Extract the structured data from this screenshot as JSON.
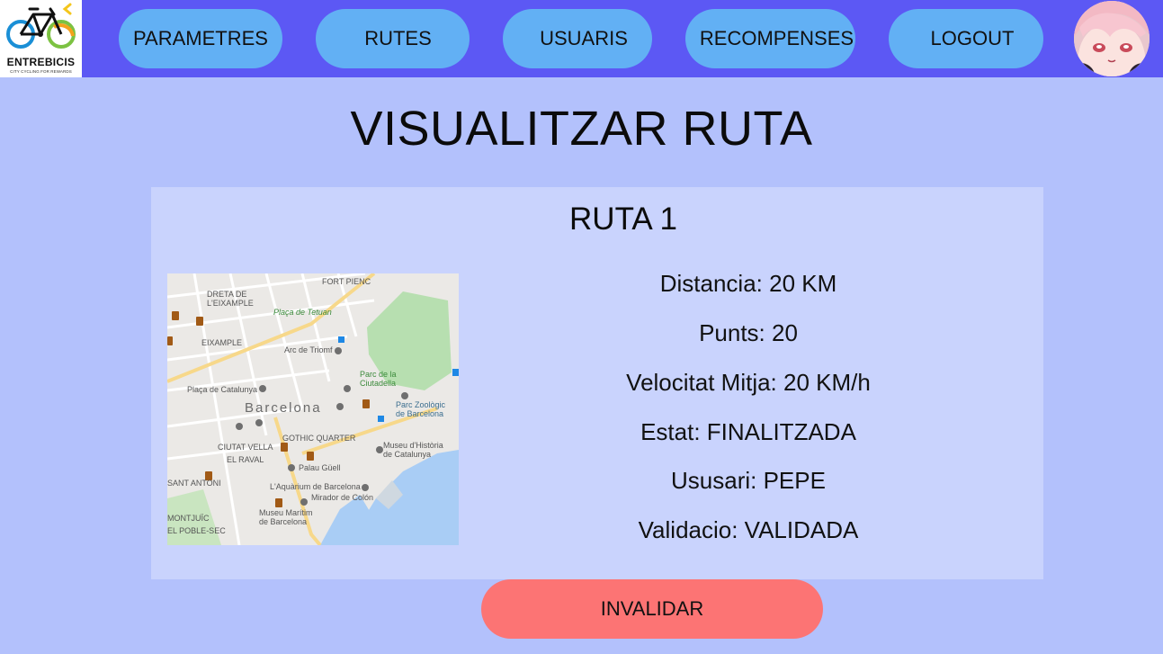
{
  "header": {
    "logo": {
      "name": "ENTREBICIS",
      "tagline": "CITY CYCLING FOR REWARDS"
    },
    "nav": [
      {
        "label": "PARAMETRES"
      },
      {
        "label": "RUTES"
      },
      {
        "label": "USUARIS"
      },
      {
        "label": "RECOMPENSES"
      },
      {
        "label": "LOGOUT"
      }
    ],
    "avatar_icon": "user-avatar"
  },
  "page": {
    "title": "VISUALITZAR RUTA"
  },
  "route": {
    "name": "RUTA 1",
    "map": {
      "labels": [
        "FORT PIENC",
        "DRETA DE\nL'EIXAMPLE",
        "Plaça de Tetuan",
        "EIXAMPLE",
        "Arc de Triomf",
        "Parc de la\nCiutadella",
        "Plaça de Catalunya",
        "Barcelona",
        "Parc Zoològic\nde Barcelona",
        "GOTHIC QUARTER",
        "CIUTAT VELLA",
        "Museu d'Història\nde Catalunya",
        "EL RAVAL",
        "Palau Güell",
        "SANT ANTONI",
        "L'Aquàrium de Barcelona",
        "Mirador de Colón",
        "Museu Marítim\nde Barcelona",
        "MONTJUÏC",
        "EL POBLE-SEC"
      ]
    },
    "details": [
      "Distancia:  20 KM",
      "Punts: 20",
      "Velocitat Mitja: 20 KM/h",
      "Estat: FINALITZADA",
      "Ususari: PEPE",
      "Validacio: VALIDADA"
    ]
  },
  "actions": {
    "invalidate_label": "INVALIDAR"
  },
  "colors": {
    "header_bg": "#5c58f4",
    "nav_button": "#62b0f4",
    "page_bg": "#b3c1fc",
    "card_bg": "#c9d3fd",
    "invalidate_button": "#fc7474"
  }
}
